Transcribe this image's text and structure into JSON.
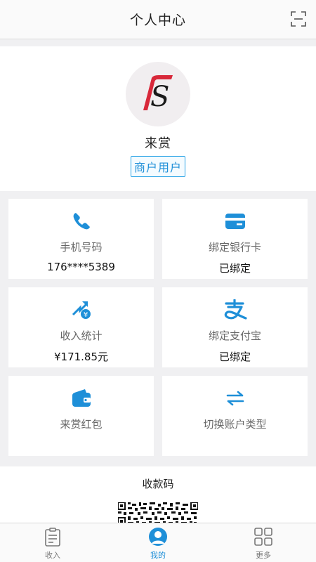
{
  "header": {
    "title": "个人中心",
    "scan_icon": "scan-icon"
  },
  "profile": {
    "name": "来赏",
    "badge": "商户用户",
    "logo_letter": "S"
  },
  "cards": [
    {
      "icon": "phone-icon",
      "label": "手机号码",
      "value": "176****5389"
    },
    {
      "icon": "bank-card-icon",
      "label": "绑定银行卡",
      "value": "已绑定"
    },
    {
      "icon": "income-chart-icon",
      "label": "收入统计",
      "value": "¥171.85元"
    },
    {
      "icon": "alipay-icon",
      "label": "绑定支付宝",
      "value": "已绑定"
    },
    {
      "icon": "wallet-icon",
      "label": "来赏红包",
      "value": ""
    },
    {
      "icon": "switch-arrows-icon",
      "label": "切换账户类型",
      "value": ""
    }
  ],
  "qr": {
    "title": "收款码"
  },
  "tabs": [
    {
      "icon": "clipboard-icon",
      "label": "收入",
      "active": false
    },
    {
      "icon": "user-icon",
      "label": "我的",
      "active": true
    },
    {
      "icon": "grid-icon",
      "label": "更多",
      "active": false
    }
  ],
  "colors": {
    "accent": "#1e8fd8",
    "logo_red": "#d8283a"
  }
}
